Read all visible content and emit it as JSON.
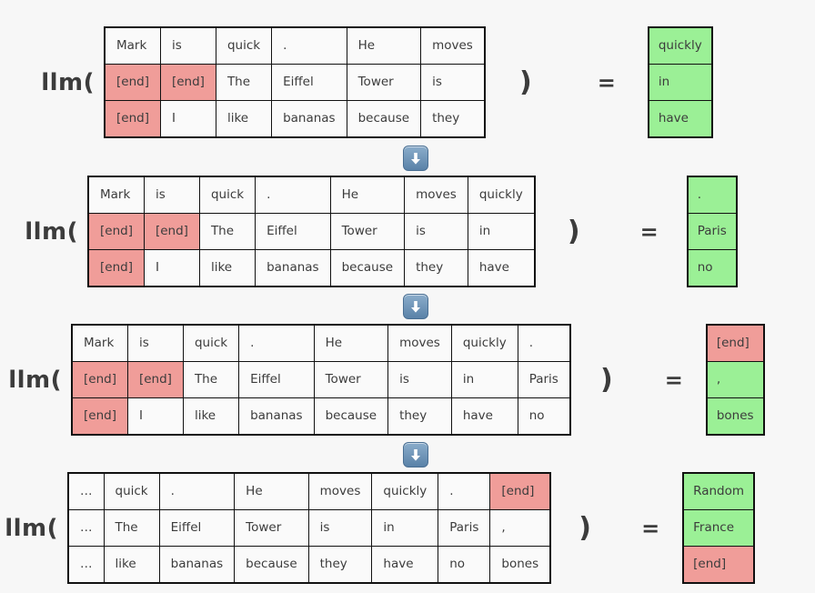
{
  "canvas": {
    "background": "#f7f7f7",
    "text_color": "#3c3c3c",
    "end_token_color": "#f09d99",
    "generated_token_color": "#9bf096",
    "cell_background": "#fafafa",
    "border_color": "#111111",
    "arrow_button_color": "#5a82a8"
  },
  "symbols": {
    "llm_open": "llm(",
    "paren_close": ")",
    "equals": "=",
    "arrow_icon": "arrow-down-icon",
    "end_token": "[end]",
    "ellipsis": "…"
  },
  "steps": [
    {
      "id": "step-1",
      "label": "llm(",
      "paren": ")",
      "equals": "=",
      "columns": 6,
      "rows": [
        {
          "cells": [
            {
              "text": "Mark",
              "kind": "token"
            },
            {
              "text": "is",
              "kind": "token"
            },
            {
              "text": "quick",
              "kind": "token"
            },
            {
              "text": ".",
              "kind": "token"
            },
            {
              "text": "He",
              "kind": "token"
            },
            {
              "text": "moves",
              "kind": "token"
            }
          ]
        },
        {
          "cells": [
            {
              "text": "[end]",
              "kind": "end"
            },
            {
              "text": "[end]",
              "kind": "end"
            },
            {
              "text": "The",
              "kind": "token"
            },
            {
              "text": "Eiffel",
              "kind": "token"
            },
            {
              "text": "Tower",
              "kind": "token"
            },
            {
              "text": "is",
              "kind": "token"
            }
          ]
        },
        {
          "cells": [
            {
              "text": "[end]",
              "kind": "end"
            },
            {
              "text": "I",
              "kind": "token"
            },
            {
              "text": "like",
              "kind": "token"
            },
            {
              "text": "bananas",
              "kind": "token"
            },
            {
              "text": "because",
              "kind": "token"
            },
            {
              "text": "they",
              "kind": "token"
            }
          ]
        }
      ],
      "output": [
        {
          "text": "quickly",
          "kind": "generated"
        },
        {
          "text": "in",
          "kind": "generated"
        },
        {
          "text": "have",
          "kind": "generated"
        }
      ]
    },
    {
      "id": "step-2",
      "label": "llm(",
      "paren": ")",
      "equals": "=",
      "columns": 7,
      "rows": [
        {
          "cells": [
            {
              "text": "Mark",
              "kind": "token"
            },
            {
              "text": "is",
              "kind": "token"
            },
            {
              "text": "quick",
              "kind": "token"
            },
            {
              "text": ".",
              "kind": "token"
            },
            {
              "text": "He",
              "kind": "token"
            },
            {
              "text": "moves",
              "kind": "token"
            },
            {
              "text": "quickly",
              "kind": "token"
            }
          ]
        },
        {
          "cells": [
            {
              "text": "[end]",
              "kind": "end"
            },
            {
              "text": "[end]",
              "kind": "end"
            },
            {
              "text": "The",
              "kind": "token"
            },
            {
              "text": "Eiffel",
              "kind": "token"
            },
            {
              "text": "Tower",
              "kind": "token"
            },
            {
              "text": "is",
              "kind": "token"
            },
            {
              "text": "in",
              "kind": "token"
            }
          ]
        },
        {
          "cells": [
            {
              "text": "[end]",
              "kind": "end"
            },
            {
              "text": "I",
              "kind": "token"
            },
            {
              "text": "like",
              "kind": "token"
            },
            {
              "text": "bananas",
              "kind": "token"
            },
            {
              "text": "because",
              "kind": "token"
            },
            {
              "text": "they",
              "kind": "token"
            },
            {
              "text": "have",
              "kind": "token"
            }
          ]
        }
      ],
      "output": [
        {
          "text": ".",
          "kind": "generated"
        },
        {
          "text": "Paris",
          "kind": "generated"
        },
        {
          "text": "no",
          "kind": "generated"
        }
      ]
    },
    {
      "id": "step-3",
      "label": "llm(",
      "paren": ")",
      "equals": "=",
      "columns": 8,
      "rows": [
        {
          "cells": [
            {
              "text": "Mark",
              "kind": "token"
            },
            {
              "text": "is",
              "kind": "token"
            },
            {
              "text": "quick",
              "kind": "token"
            },
            {
              "text": ".",
              "kind": "token"
            },
            {
              "text": "He",
              "kind": "token"
            },
            {
              "text": "moves",
              "kind": "token"
            },
            {
              "text": "quickly",
              "kind": "token"
            },
            {
              "text": ".",
              "kind": "token"
            }
          ]
        },
        {
          "cells": [
            {
              "text": "[end]",
              "kind": "end"
            },
            {
              "text": "[end]",
              "kind": "end"
            },
            {
              "text": "The",
              "kind": "token"
            },
            {
              "text": "Eiffel",
              "kind": "token"
            },
            {
              "text": "Tower",
              "kind": "token"
            },
            {
              "text": "is",
              "kind": "token"
            },
            {
              "text": "in",
              "kind": "token"
            },
            {
              "text": "Paris",
              "kind": "token"
            }
          ]
        },
        {
          "cells": [
            {
              "text": "[end]",
              "kind": "end"
            },
            {
              "text": "I",
              "kind": "token"
            },
            {
              "text": "like",
              "kind": "token"
            },
            {
              "text": "bananas",
              "kind": "token"
            },
            {
              "text": "because",
              "kind": "token"
            },
            {
              "text": "they",
              "kind": "token"
            },
            {
              "text": "have",
              "kind": "token"
            },
            {
              "text": "no",
              "kind": "token"
            }
          ]
        }
      ],
      "output": [
        {
          "text": "[end]",
          "kind": "end"
        },
        {
          "text": ",",
          "kind": "generated"
        },
        {
          "text": "bones",
          "kind": "generated"
        }
      ]
    },
    {
      "id": "step-4",
      "label": "llm(",
      "paren": ")",
      "equals": "=",
      "columns": 8,
      "rows": [
        {
          "cells": [
            {
              "text": "…",
              "kind": "token"
            },
            {
              "text": "quick",
              "kind": "token"
            },
            {
              "text": ".",
              "kind": "token"
            },
            {
              "text": "He",
              "kind": "token"
            },
            {
              "text": "moves",
              "kind": "token"
            },
            {
              "text": "quickly",
              "kind": "token"
            },
            {
              "text": ".",
              "kind": "token"
            },
            {
              "text": "[end]",
              "kind": "end"
            }
          ]
        },
        {
          "cells": [
            {
              "text": "…",
              "kind": "token"
            },
            {
              "text": "The",
              "kind": "token"
            },
            {
              "text": "Eiffel",
              "kind": "token"
            },
            {
              "text": "Tower",
              "kind": "token"
            },
            {
              "text": "is",
              "kind": "token"
            },
            {
              "text": "in",
              "kind": "token"
            },
            {
              "text": "Paris",
              "kind": "token"
            },
            {
              "text": ",",
              "kind": "token"
            }
          ]
        },
        {
          "cells": [
            {
              "text": "…",
              "kind": "token"
            },
            {
              "text": "like",
              "kind": "token"
            },
            {
              "text": "bananas",
              "kind": "token"
            },
            {
              "text": "because",
              "kind": "token"
            },
            {
              "text": "they",
              "kind": "token"
            },
            {
              "text": "have",
              "kind": "token"
            },
            {
              "text": "no",
              "kind": "token"
            },
            {
              "text": "bones",
              "kind": "token"
            }
          ]
        }
      ],
      "output": [
        {
          "text": "Random",
          "kind": "generated"
        },
        {
          "text": "France",
          "kind": "generated"
        },
        {
          "text": "[end]",
          "kind": "end"
        }
      ]
    }
  ],
  "arrows": [
    {
      "id": "arrow-1",
      "icon": "arrow-down-icon"
    },
    {
      "id": "arrow-2",
      "icon": "arrow-down-icon"
    },
    {
      "id": "arrow-3",
      "icon": "arrow-down-icon"
    }
  ]
}
